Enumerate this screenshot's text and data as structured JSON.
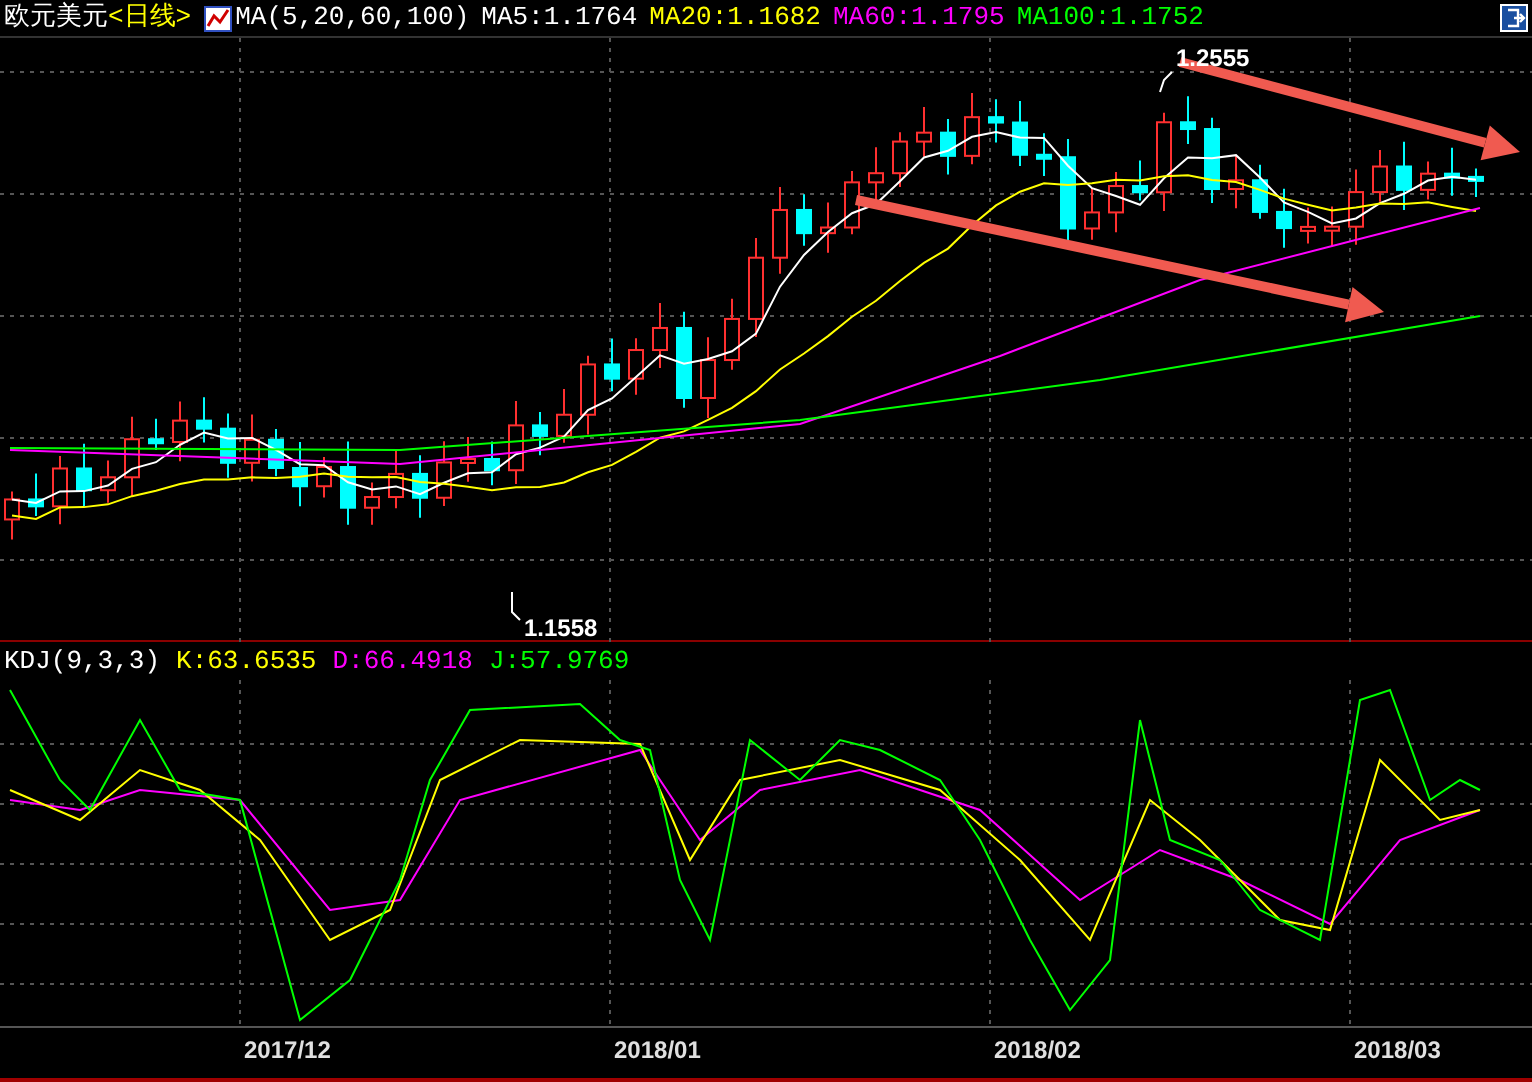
{
  "title": {
    "symbol": "欧元美元",
    "period": "<日线>"
  },
  "ma_legend": {
    "label": "MA(5,20,60,100)",
    "items": [
      {
        "text": "MA5:1.1764",
        "color": "#ffffff"
      },
      {
        "text": "MA20:1.1682",
        "color": "#ffff00"
      },
      {
        "text": "MA60:1.1795",
        "color": "#ff00ff"
      },
      {
        "text": "MA100:1.1752",
        "color": "#00ff00"
      }
    ]
  },
  "price_chart": {
    "high_label": "1.2555",
    "low_label": "1.1558"
  },
  "kdj_legend": {
    "label": "KDJ(9,3,3)",
    "items": [
      {
        "text": "K:63.6535",
        "color": "#ffff00"
      },
      {
        "text": "D:66.4918",
        "color": "#ff00ff"
      },
      {
        "text": "J:57.9769",
        "color": "#00ff00"
      }
    ]
  },
  "x_axis": {
    "labels": [
      "2017/12",
      "2018/01",
      "2018/02",
      "2018/03"
    ]
  }
}
